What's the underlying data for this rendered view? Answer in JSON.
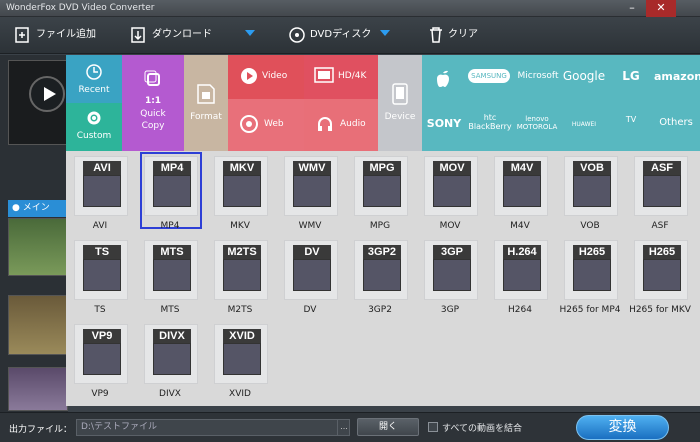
{
  "app": {
    "title": "WonderFox DVD Video Converter"
  },
  "toolbar": {
    "add_files": "ファイル追加",
    "download": "ダウンロード",
    "dvd_disc": "DVDディスク",
    "clear": "クリア"
  },
  "left": {
    "tab_label": "メイン"
  },
  "categories": {
    "recent": "Recent",
    "custom": "Custom",
    "quick_copy_ratio": "1:1",
    "quick_copy": "Quick\nCopy",
    "format": "Format",
    "video": "Video",
    "web": "Web",
    "hd4k": "HD/4K",
    "audio": "Audio",
    "device": "Device"
  },
  "brands": [
    "SAMSUNG",
    "Microsoft",
    "Google",
    "LG",
    "amazon",
    "SONY",
    "htc BlackBerry",
    "lenovo MOTOROLA",
    "HUAWEI",
    "TV",
    "Others"
  ],
  "formats": [
    {
      "head": "AVI",
      "label": "AVI"
    },
    {
      "head": "MP4",
      "label": "MP4"
    },
    {
      "head": "MKV",
      "label": "MKV"
    },
    {
      "head": "WMV",
      "label": "WMV"
    },
    {
      "head": "MPG",
      "label": "MPG"
    },
    {
      "head": "MOV",
      "label": "MOV"
    },
    {
      "head": "M4V",
      "label": "M4V"
    },
    {
      "head": "VOB",
      "label": "VOB"
    },
    {
      "head": "ASF",
      "label": "ASF"
    },
    {
      "head": "TS",
      "label": "TS"
    },
    {
      "head": "MTS",
      "label": "MTS"
    },
    {
      "head": "M2TS",
      "label": "M2TS"
    },
    {
      "head": "DV",
      "label": "DV"
    },
    {
      "head": "3GP2",
      "label": "3GP2"
    },
    {
      "head": "3GP",
      "label": "3GP"
    },
    {
      "head": "H.264",
      "label": "H264"
    },
    {
      "head": "H265",
      "label": "H265 for MP4"
    },
    {
      "head": "H265",
      "label": "H265 for MKV"
    },
    {
      "head": "VP9",
      "label": "VP9"
    },
    {
      "head": "DIVX",
      "label": "DIVX"
    },
    {
      "head": "XVID",
      "label": "XVID"
    }
  ],
  "selected_format": "MP4",
  "footer": {
    "output_label": "出力ファイル：",
    "output_path": "D:\\テストファイル",
    "more": "...",
    "open": "開く",
    "merge_label": "すべての動画を結合",
    "convert": "変換"
  },
  "colors": {
    "recent": "#3aa3c3",
    "custom": "#2db49a",
    "quick_copy": "#b45ad0",
    "format": "#c8b6a2",
    "video": "#e0505a",
    "web": "#e8707a",
    "hd4k": "#e05060",
    "audio": "#e86f78",
    "device": "#c4c6cb",
    "brands": "#58b8c0",
    "convert": "#1e80d6"
  }
}
